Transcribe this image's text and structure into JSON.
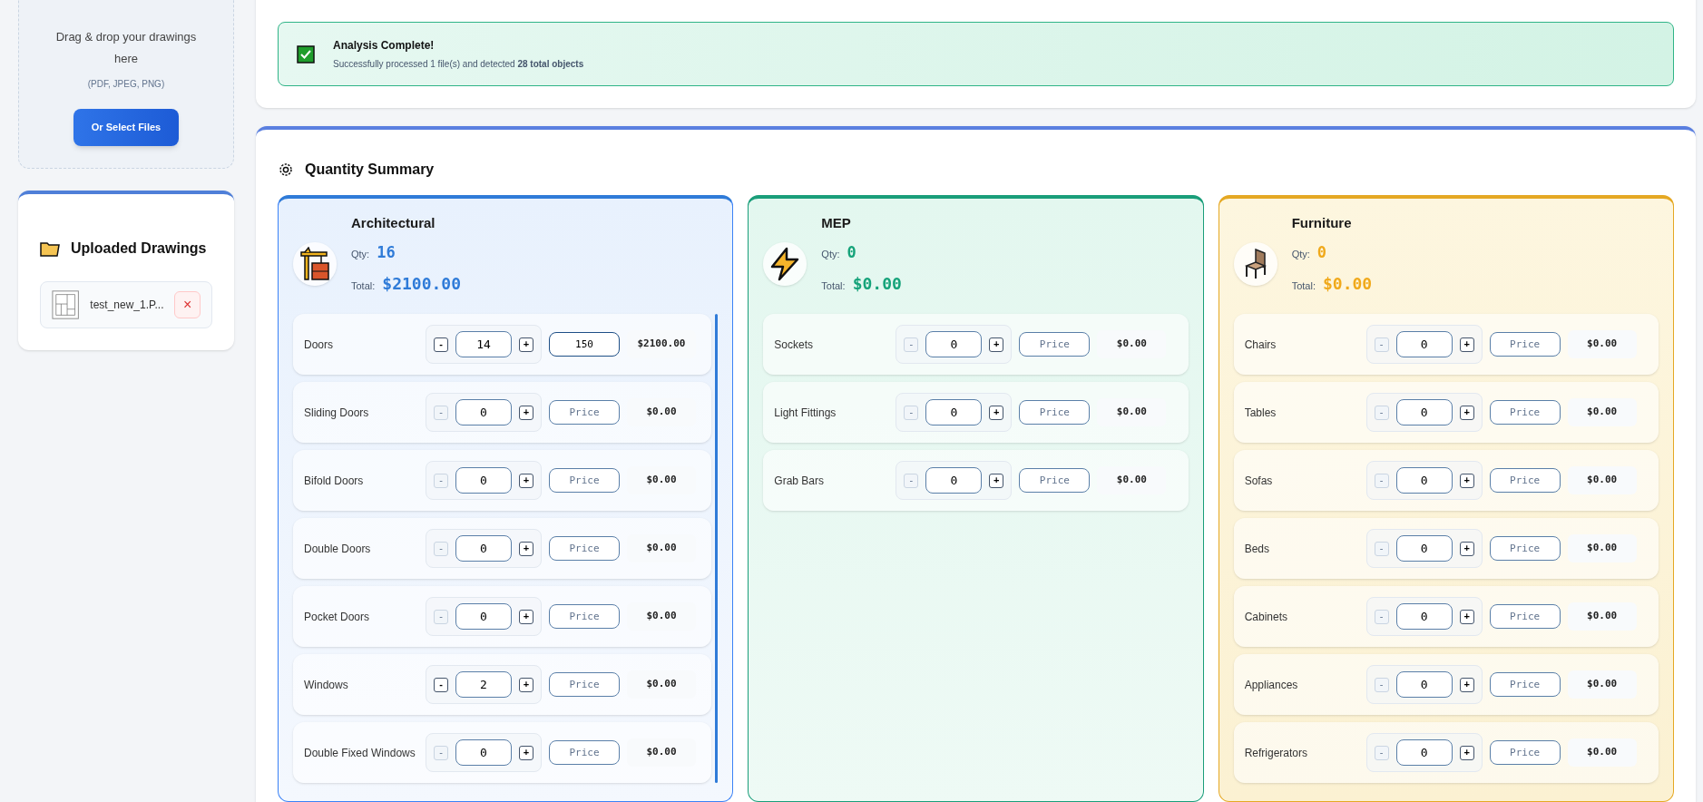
{
  "upload": {
    "prompt": "Drag & drop your drawings here",
    "formats": "(PDF, JPEG, PNG)",
    "button": "Or Select Files"
  },
  "uploaded": {
    "title": "Uploaded Drawings",
    "files": [
      {
        "name": "test_new_1.P...",
        "remove": "×"
      }
    ]
  },
  "analysis": {
    "title": "Analysis Complete!",
    "message": "Successfully processed 1 file(s) and detected **28 total objects**"
  },
  "summary": {
    "title": "Quantity Summary",
    "categories": [
      {
        "kind": "architectural",
        "name": "Architectural",
        "qty_label": "Qty:",
        "qty": "16",
        "total_label": "Total:",
        "total": "$2100.00",
        "items": [
          {
            "name": "Doors",
            "decrement": "-",
            "qty": "14",
            "increment": "+",
            "decrement_disabled": false,
            "price": "150",
            "total": "$2100.00"
          },
          {
            "name": "Sliding Doors",
            "decrement": "-",
            "qty": "0",
            "increment": "+",
            "decrement_disabled": true,
            "price_placeholder": "Price",
            "total": "$0.00"
          },
          {
            "name": "Bifold Doors",
            "decrement": "-",
            "qty": "0",
            "increment": "+",
            "decrement_disabled": true,
            "price_placeholder": "Price",
            "total": "$0.00"
          },
          {
            "name": "Double Doors",
            "decrement": "-",
            "qty": "0",
            "increment": "+",
            "decrement_disabled": true,
            "price_placeholder": "Price",
            "total": "$0.00"
          },
          {
            "name": "Pocket Doors",
            "decrement": "-",
            "qty": "0",
            "increment": "+",
            "decrement_disabled": true,
            "price_placeholder": "Price",
            "total": "$0.00"
          },
          {
            "name": "Windows",
            "decrement": "-",
            "qty": "2",
            "increment": "+",
            "decrement_disabled": false,
            "price_placeholder": "Price",
            "total": "$0.00"
          },
          {
            "name": "Double Fixed Windows",
            "decrement": "-",
            "qty": "0",
            "increment": "+",
            "decrement_disabled": true,
            "price_placeholder": "Price",
            "total": "$0.00"
          }
        ]
      },
      {
        "kind": "mep",
        "name": "MEP",
        "qty_label": "Qty:",
        "qty": "0",
        "total_label": "Total:",
        "total": "$0.00",
        "items": [
          {
            "name": "Sockets",
            "decrement": "-",
            "qty": "0",
            "increment": "+",
            "decrement_disabled": true,
            "price_placeholder": "Price",
            "total": "$0.00"
          },
          {
            "name": "Light Fittings",
            "decrement": "-",
            "qty": "0",
            "increment": "+",
            "decrement_disabled": true,
            "price_placeholder": "Price",
            "total": "$0.00"
          },
          {
            "name": "Grab Bars",
            "decrement": "-",
            "qty": "0",
            "increment": "+",
            "decrement_disabled": true,
            "price_placeholder": "Price",
            "total": "$0.00"
          }
        ]
      },
      {
        "kind": "furniture",
        "name": "Furniture",
        "qty_label": "Qty:",
        "qty": "0",
        "total_label": "Total:",
        "total": "$0.00",
        "items": [
          {
            "name": "Chairs",
            "decrement": "-",
            "qty": "0",
            "increment": "+",
            "decrement_disabled": true,
            "price_placeholder": "Price",
            "total": "$0.00"
          },
          {
            "name": "Tables",
            "decrement": "-",
            "qty": "0",
            "increment": "+",
            "decrement_disabled": true,
            "price_placeholder": "Price",
            "total": "$0.00"
          },
          {
            "name": "Sofas",
            "decrement": "-",
            "qty": "0",
            "increment": "+",
            "decrement_disabled": true,
            "price_placeholder": "Price",
            "total": "$0.00"
          },
          {
            "name": "Beds",
            "decrement": "-",
            "qty": "0",
            "increment": "+",
            "decrement_disabled": true,
            "price_placeholder": "Price",
            "total": "$0.00"
          },
          {
            "name": "Cabinets",
            "decrement": "-",
            "qty": "0",
            "increment": "+",
            "decrement_disabled": true,
            "price_placeholder": "Price",
            "total": "$0.00"
          },
          {
            "name": "Appliances",
            "decrement": "-",
            "qty": "0",
            "increment": "+",
            "decrement_disabled": true,
            "price_placeholder": "Price",
            "total": "$0.00"
          },
          {
            "name": "Refrigerators",
            "decrement": "-",
            "qty": "0",
            "increment": "+",
            "decrement_disabled": true,
            "price_placeholder": "Price",
            "total": "$0.00"
          }
        ]
      }
    ]
  }
}
